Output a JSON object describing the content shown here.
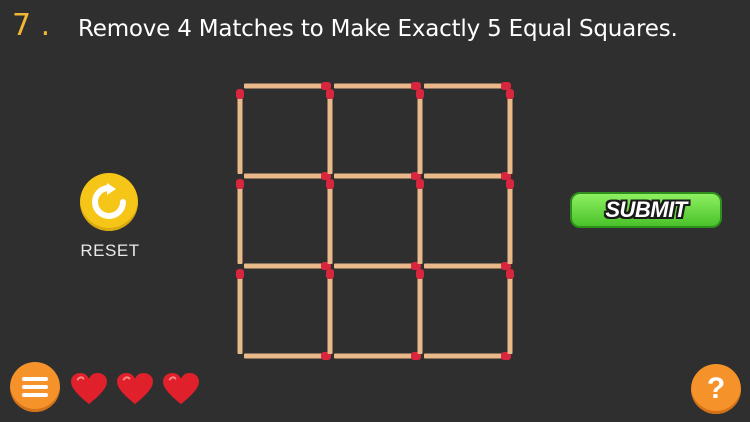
{
  "level": {
    "number": "7 ."
  },
  "instruction": "Remove 4 Matches to Make Exactly 5 Equal Squares.",
  "puzzle": {
    "grid_cells": 3,
    "match_color": "#e9b98a",
    "head_color": "#d7263d"
  },
  "reset": {
    "label": "RESET",
    "icon": "reset-arrow-icon"
  },
  "submit": {
    "label": "SUBMIT"
  },
  "lives": {
    "count": 3,
    "icon": "heart-icon",
    "color": "#e0202a"
  },
  "menu": {
    "icon": "hamburger-menu-icon"
  },
  "help": {
    "label": "?"
  },
  "colors": {
    "level_number": "#f2b632",
    "background": "#2f2f2f",
    "button_orange": "#f5932a",
    "button_yellow": "#f5c518",
    "submit_green": "#5cd63a"
  }
}
